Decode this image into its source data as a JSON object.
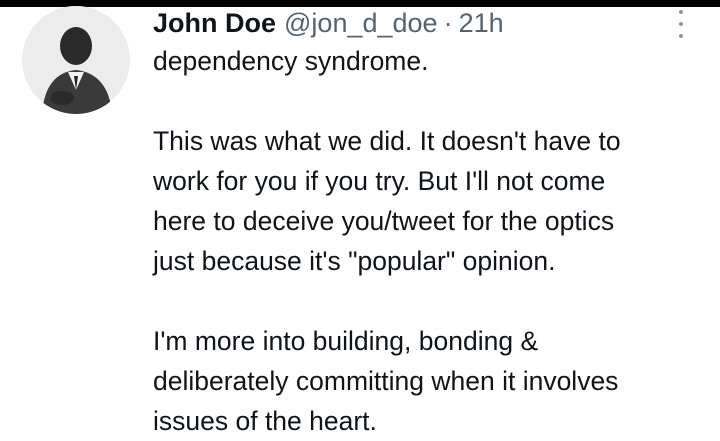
{
  "tweet": {
    "author": {
      "name": "John Doe",
      "handle": "@jon_d_doe"
    },
    "separator": "·",
    "time": "21h",
    "paragraphs": [
      [
        "dependency syndrome."
      ],
      [
        "This was what we did. It doesn't have to",
        "work for you if you try. But I'll not come",
        "here to deceive you/tweet for the optics",
        "just because it's \"popular\" opinion."
      ],
      [
        "I'm more into building, bonding &",
        "deliberately committing when it involves",
        "issues of the heart."
      ]
    ]
  },
  "icons": {
    "more": "more-vertical-icon",
    "avatar": "profile-photo"
  },
  "colors": {
    "text": "#0f1419",
    "secondary": "#536471",
    "background": "#ffffff"
  }
}
